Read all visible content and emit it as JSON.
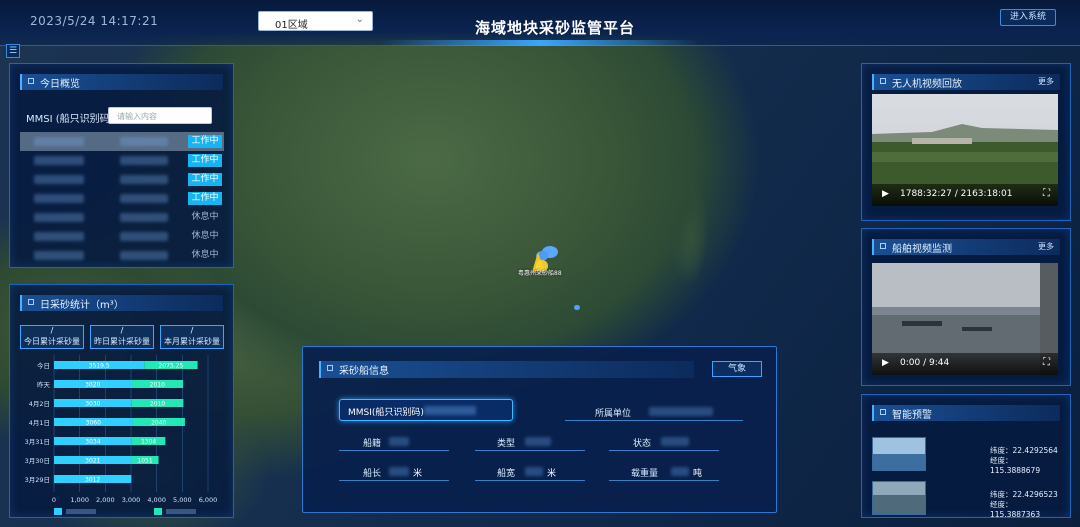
{
  "header": {
    "datetime": "2023/5/24 14:17:21",
    "region_select": "01区域",
    "title": "海域地块采砂监管平台",
    "enter_button": "进入系统"
  },
  "map": {
    "ship_label": "粤惠州采砂船88"
  },
  "today_ships": {
    "title": "今日概览",
    "mmsi_label": "MMSI (船只识别码):",
    "mmsi_placeholder": "请输入内容",
    "rows": [
      {
        "status": "工作中",
        "active": true
      },
      {
        "status": "工作中",
        "active": true
      },
      {
        "status": "工作中",
        "active": true
      },
      {
        "status": "工作中",
        "active": true
      },
      {
        "status": "休息中",
        "active": false
      },
      {
        "status": "休息中",
        "active": false
      },
      {
        "status": "休息中",
        "active": false
      }
    ]
  },
  "sand_stats": {
    "title": "日采砂统计（m³）",
    "cards": [
      {
        "value": "/",
        "label": "今日累计采砂量"
      },
      {
        "value": "/",
        "label": "昨日累计采砂量"
      },
      {
        "value": "/",
        "label": "本月累计采砂量"
      }
    ]
  },
  "chart_data": {
    "type": "bar",
    "orientation": "horizontal",
    "stacked": true,
    "categories": [
      "今日",
      "昨天",
      "4月2日",
      "4月1日",
      "3月31日",
      "3月30日",
      "3月29日"
    ],
    "series": [
      {
        "values": [
          3519,
          3020,
          3030,
          3060,
          3034,
          3021,
          3012
        ],
        "color": "#2fd0ff"
      },
      {
        "values": [
          2075,
          2010,
          2010,
          2040,
          1304,
          1051,
          0
        ],
        "color": "#22e8b8"
      }
    ],
    "value_labels": {
      "s1": [
        "3519.5",
        "3020",
        "3030",
        "3060",
        "3034",
        "3021",
        "3012"
      ],
      "s2": [
        "2075.25",
        "2010",
        "2010",
        "2040",
        "1304",
        "1051",
        ""
      ]
    },
    "xticks": [
      "0",
      "1,000",
      "2,000",
      "3,000",
      "4,000",
      "5,000",
      "6,000"
    ],
    "xlim": [
      0,
      6000
    ],
    "grid": true,
    "legend": "bottom"
  },
  "drone_video": {
    "title": "无人机视频回放",
    "more": "更多",
    "time": "1788:32:27 / 2163:18:01"
  },
  "ship_video": {
    "title": "船舶视频监测",
    "more": "更多",
    "time": "0:00 / 9:44"
  },
  "alerts": {
    "title": "智能预警",
    "items": [
      {
        "lat": "纬度：22.4292564",
        "lng": "经度：115.3888679"
      },
      {
        "lat": "纬度：22.4296523",
        "lng": "经度：115.3887363"
      }
    ]
  },
  "ship_info": {
    "title": "采砂船信息",
    "weather": "气象",
    "mmsi_label": "MMSI(船只识别码)",
    "owner_label": "所属单位",
    "row2": {
      "reg": "船籍",
      "type": "类型",
      "state": "状态"
    },
    "row3": {
      "length": "船长",
      "length_unit": "米",
      "width": "船宽",
      "width_unit": "米",
      "load": "载重量",
      "load_unit": "吨"
    }
  }
}
